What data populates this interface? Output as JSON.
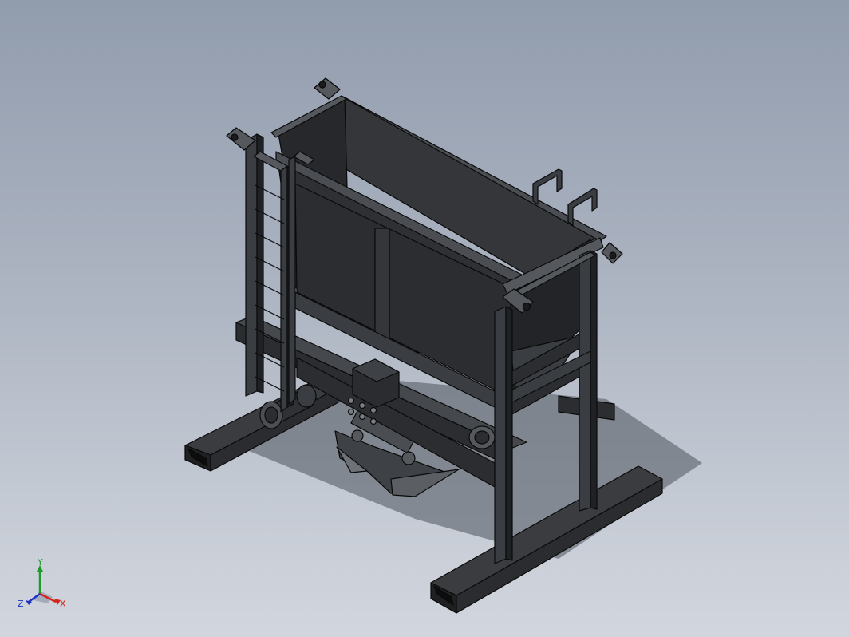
{
  "viewport": {
    "background_top": "#919cad",
    "background_bottom": "#d2d6de"
  },
  "model": {
    "body_color": "#2b2d30",
    "edge_color": "#0a0a0a",
    "highlight_color": "#6e7277",
    "shadow_color": "#4d535c"
  },
  "triad": {
    "x_label": "X",
    "y_label": "Y",
    "z_label": "Z",
    "x_color": "#d8231b",
    "y_color": "#1c9b2a",
    "z_color": "#1d2fc4"
  }
}
